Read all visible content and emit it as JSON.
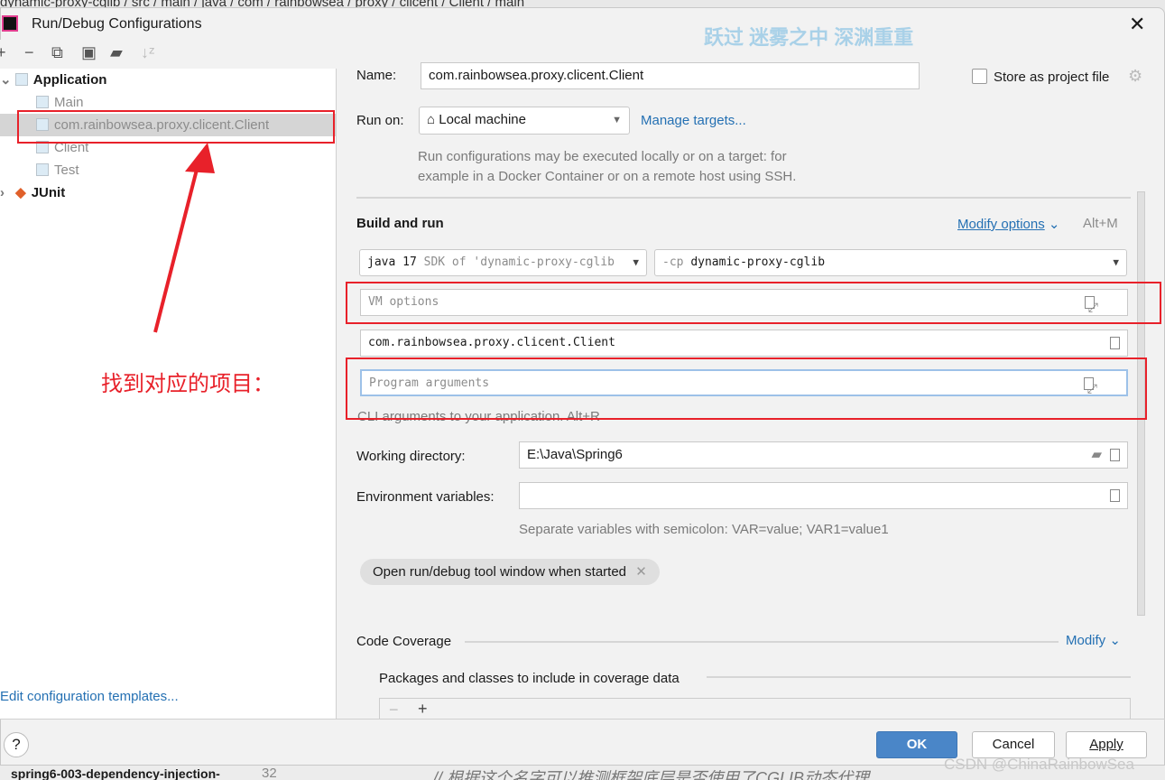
{
  "background": {
    "breadcrumb": "dynamic-proxy-cglib / src / main / java / com / rainbowsea / proxy / clicent / Client / main",
    "project_item": "spring6-003-dependency-injection-",
    "count": "32",
    "code_comment": "// 根据这个名字可以推测框架底层是否使用了CGLIB动态代理"
  },
  "dialog": {
    "title": "Run/Debug Configurations",
    "watermark": "跃过 迷雾之中 深渊重重"
  },
  "toolbar": {
    "icons": [
      "plus-icon",
      "minus-icon",
      "copy-icon",
      "save-icon",
      "folder-add-icon",
      "sort-icon"
    ]
  },
  "tree": {
    "application": "Application",
    "items": [
      "Main",
      "com.rainbowsea.proxy.clicent.Client",
      "Client",
      "Test"
    ],
    "junit": "JUnit"
  },
  "annotation": "找到对应的项目：",
  "edit_templates": "Edit configuration templates...",
  "form": {
    "name_label": "Name:",
    "name_value": "com.rainbowsea.proxy.clicent.Client",
    "store_label": "Store as project file",
    "run_on_label": "Run on:",
    "run_on_value": "Local machine",
    "manage_targets": "Manage targets...",
    "run_on_hint1": "Run configurations may be executed locally or on a target: for",
    "run_on_hint2": "example in a Docker Container or on a remote host using SSH.",
    "build_run": "Build and run",
    "modify_options": "Modify options",
    "modify_shortcut": "Alt+M",
    "jdk_bold": "java 17",
    "jdk_rest": " SDK of 'dynamic-proxy-cglib",
    "cp_flag": "-cp",
    "cp_value": "dynamic-proxy-cglib",
    "vm_placeholder": "VM options",
    "main_class": "com.rainbowsea.proxy.clicent.Client",
    "program_placeholder": "Program arguments",
    "cli_hint": "CLI arguments to your application. Alt+R",
    "workdir_label": "Working directory:",
    "workdir_value": "E:\\Java\\Spring6",
    "env_label": "Environment variables:",
    "env_value": "",
    "env_hint": "Separate variables with semicolon: VAR=value; VAR1=value1",
    "chip": "Open run/debug tool window when started",
    "coverage": "Code Coverage",
    "modify": "Modify",
    "packages": "Packages and classes to include in coverage data"
  },
  "footer": {
    "help": "?",
    "ok": "OK",
    "cancel": "Cancel",
    "apply": "Apply"
  },
  "credit": "CSDN @ChinaRainbowSea",
  "colors": {
    "accent": "#2470b3",
    "ok": "#4a86c8",
    "annotation": "#e8212a"
  }
}
